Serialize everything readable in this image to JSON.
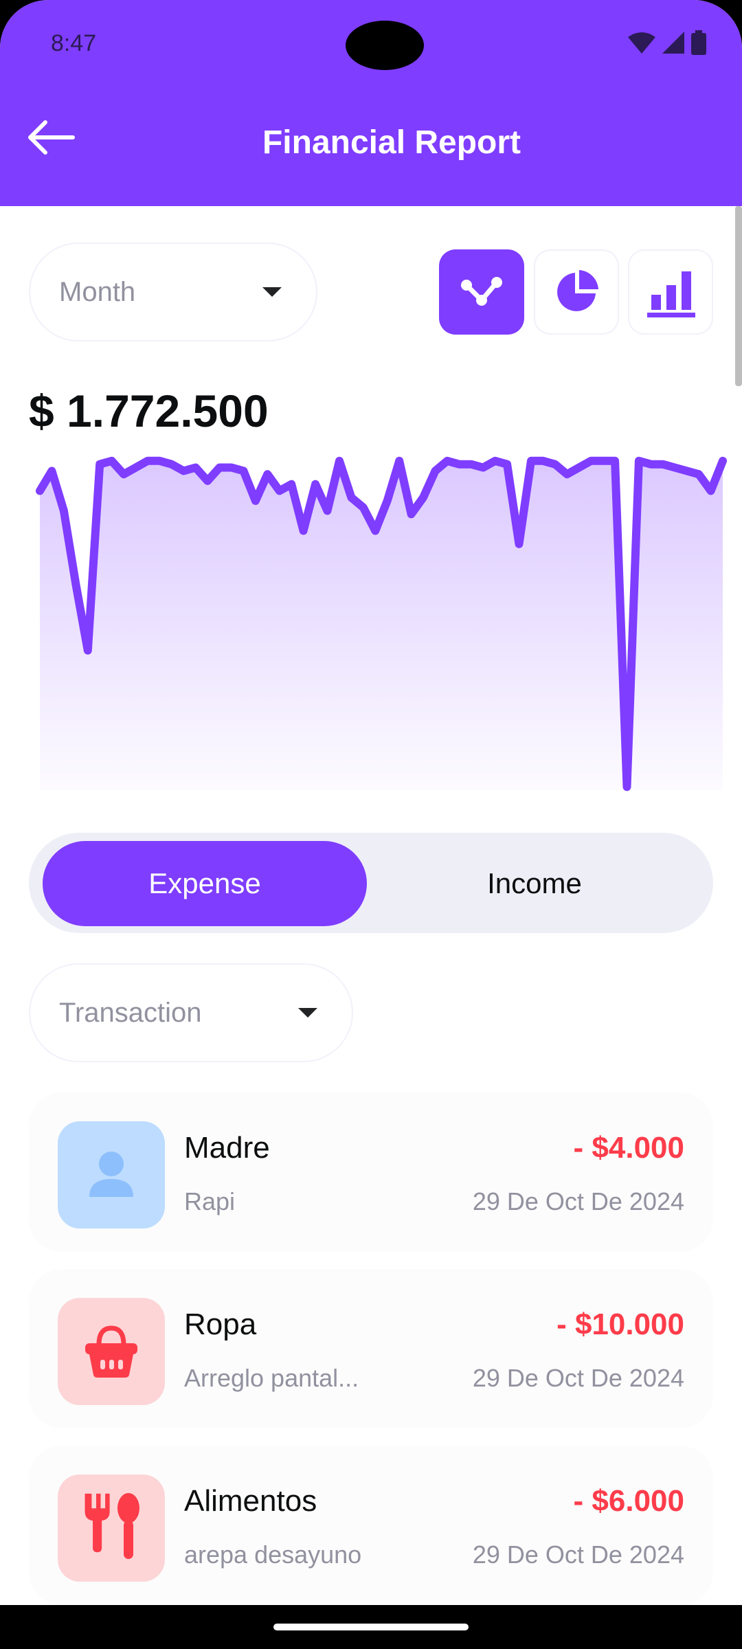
{
  "status": {
    "time": "8:47"
  },
  "header": {
    "title": "Financial Report"
  },
  "filters": {
    "period": "Month",
    "transaction": "Transaction"
  },
  "chart_buttons": {
    "active": "line"
  },
  "total": "$ 1.772.500",
  "toggle": {
    "expense": "Expense",
    "income": "Income",
    "selected": "Expense"
  },
  "chart_data": {
    "type": "area",
    "title": "",
    "xlabel": "",
    "ylabel": "",
    "values": [
      0.9,
      0.96,
      0.84,
      0.62,
      0.42,
      0.98,
      0.99,
      0.95,
      0.97,
      0.99,
      0.99,
      0.98,
      0.96,
      0.97,
      0.93,
      0.97,
      0.97,
      0.96,
      0.87,
      0.95,
      0.9,
      0.92,
      0.78,
      0.92,
      0.84,
      0.99,
      0.88,
      0.85,
      0.78,
      0.87,
      0.99,
      0.83,
      0.88,
      0.96,
      0.99,
      0.98,
      0.98,
      0.97,
      0.99,
      0.98,
      0.74,
      0.99,
      0.99,
      0.98,
      0.95,
      0.97,
      0.99,
      0.99,
      0.99,
      0.01,
      0.99,
      0.98,
      0.98,
      0.97,
      0.96,
      0.95,
      0.9,
      0.99
    ],
    "color": "#7F3DFF"
  },
  "transactions": [
    {
      "name": "Madre",
      "desc": "Rapi",
      "amount": "- $4.000",
      "date": "29 De Oct De 2024",
      "icon": "person-icon",
      "bg": "#BDDCFF",
      "fg": "#8DBFFC"
    },
    {
      "name": "Ropa",
      "desc": "Arreglo pantal...",
      "amount": "- $10.000",
      "date": "29 De Oct De 2024",
      "icon": "shopping-basket-icon",
      "bg": "#FDD5D7",
      "fg": "#FD3C4A"
    },
    {
      "name": "Alimentos",
      "desc": "arepa desayuno",
      "amount": "- $6.000",
      "date": "29 De Oct De 2024",
      "icon": "restaurant-icon",
      "bg": "#FDD5D7",
      "fg": "#FD3C4A"
    }
  ]
}
